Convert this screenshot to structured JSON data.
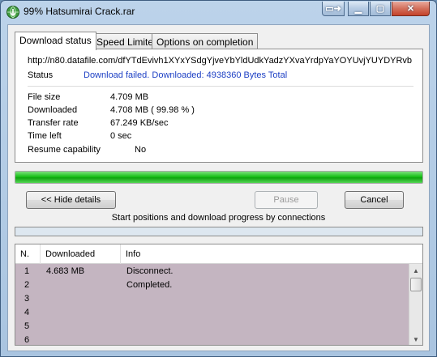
{
  "window": {
    "title": "99% Hatsumirai Crack.rar",
    "caption_min": "▁",
    "caption_max": "▢",
    "caption_close": "✕",
    "caption_extra": "▭➜",
    "icon": "idm-globe-icon"
  },
  "tabs": [
    "Download status",
    "Speed Limiter",
    "Options on completion"
  ],
  "status": {
    "url": "http://n80.datafile.com/dfYTdEvivh1XYxYSdgYjveYbYldUdkYadzYXvaYrdpYaYOYUvjYUYDYRvb",
    "status_label": "Status",
    "status_value": "Download failed. Downloaded: 4938360 Bytes Total",
    "status_color": "#1c3fc4",
    "fields": [
      {
        "label": "File size",
        "value": "4.709  MB"
      },
      {
        "label": "Downloaded",
        "value": "4.708  MB  ( 99.98 % )"
      },
      {
        "label": "Transfer rate",
        "value": "67.249  KB/sec"
      },
      {
        "label": "Time left",
        "value": "0 sec"
      },
      {
        "label": "Resume capability",
        "value": "No"
      }
    ]
  },
  "progress": {
    "fraction": 0.9998,
    "color": "#18c018"
  },
  "buttons": {
    "hide_details": "<< Hide details",
    "pause": "Pause",
    "cancel": "Cancel"
  },
  "connections": {
    "caption": "Start positions and download progress by connections",
    "columns": [
      "N.",
      "Downloaded",
      "Info"
    ],
    "rows": [
      {
        "n": "1",
        "downloaded": "4.683  MB",
        "info": "Disconnect."
      },
      {
        "n": "2",
        "downloaded": "",
        "info": "Completed."
      },
      {
        "n": "3",
        "downloaded": "",
        "info": ""
      },
      {
        "n": "4",
        "downloaded": "",
        "info": ""
      },
      {
        "n": "5",
        "downloaded": "",
        "info": ""
      },
      {
        "n": "6",
        "downloaded": "",
        "info": ""
      }
    ],
    "scroll_up": "▲",
    "scroll_down": "▼"
  }
}
